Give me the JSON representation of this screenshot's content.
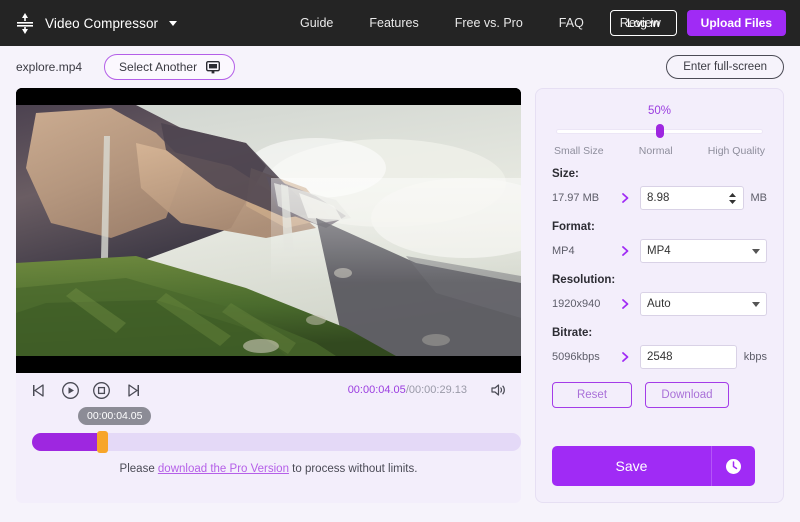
{
  "topbar": {
    "logo_icon": "compress-icon",
    "brand_name": "Video Compressor",
    "caret_icon": "chevron-down-icon",
    "nav": [
      {
        "label": "Guide"
      },
      {
        "label": "Features"
      },
      {
        "label": "Free vs. Pro"
      },
      {
        "label": "FAQ"
      },
      {
        "label": "Review"
      }
    ],
    "login_label": "Log in",
    "upload_label": "Upload Files",
    "upload_color": "#a02bf5",
    "background_color": "#242424"
  },
  "subbar": {
    "filename": "explore.mp4",
    "select_another_label": "Select Another",
    "select_another_icon": "monitor-icon",
    "fullscreen_label": "Enter full-screen"
  },
  "player": {
    "controls": {
      "prev_frame_icon": "step-backward-icon",
      "play_icon": "play-circle-icon",
      "stop_icon": "stop-circle-icon",
      "next_frame_icon": "step-forward-icon",
      "volume_icon": "speaker-icon"
    },
    "current_time": "00:00:04.05",
    "time_separator": "/",
    "total_time": "00:00:29.13",
    "tooltip_time": "00:00:04.05",
    "progress_percent": 13,
    "progress_fill_color": "#9e27e0",
    "handle_color": "#f7a529",
    "pro_note_prefix": "Please ",
    "pro_note_link": "download the Pro Version",
    "pro_note_suffix": " to process without limits."
  },
  "settings": {
    "quality_percent": "50%",
    "slider_labels": {
      "low": "Small Size",
      "mid": "Normal",
      "high": "High Quality"
    },
    "size": {
      "label": "Size:",
      "original": "17.97 MB",
      "arrow_icon": "chevron-right-icon",
      "value": "8.98",
      "unit": "MB",
      "spinner_icon": "spinner-updown-icon"
    },
    "format": {
      "label": "Format:",
      "original": "MP4",
      "arrow_icon": "chevron-right-icon",
      "value": "MP4",
      "caret_icon": "chevron-down-icon"
    },
    "resolution": {
      "label": "Resolution:",
      "original": "1920x940",
      "arrow_icon": "chevron-right-icon",
      "value": "Auto",
      "caret_icon": "chevron-down-icon"
    },
    "bitrate": {
      "label": "Bitrate:",
      "original": "5096kbps",
      "arrow_icon": "chevron-right-icon",
      "value": "2548",
      "unit": "kbps"
    },
    "reset_label": "Reset",
    "download_label": "Download",
    "save_label": "Save",
    "history_icon": "clock-icon",
    "accent_color": "#a02bf5"
  }
}
